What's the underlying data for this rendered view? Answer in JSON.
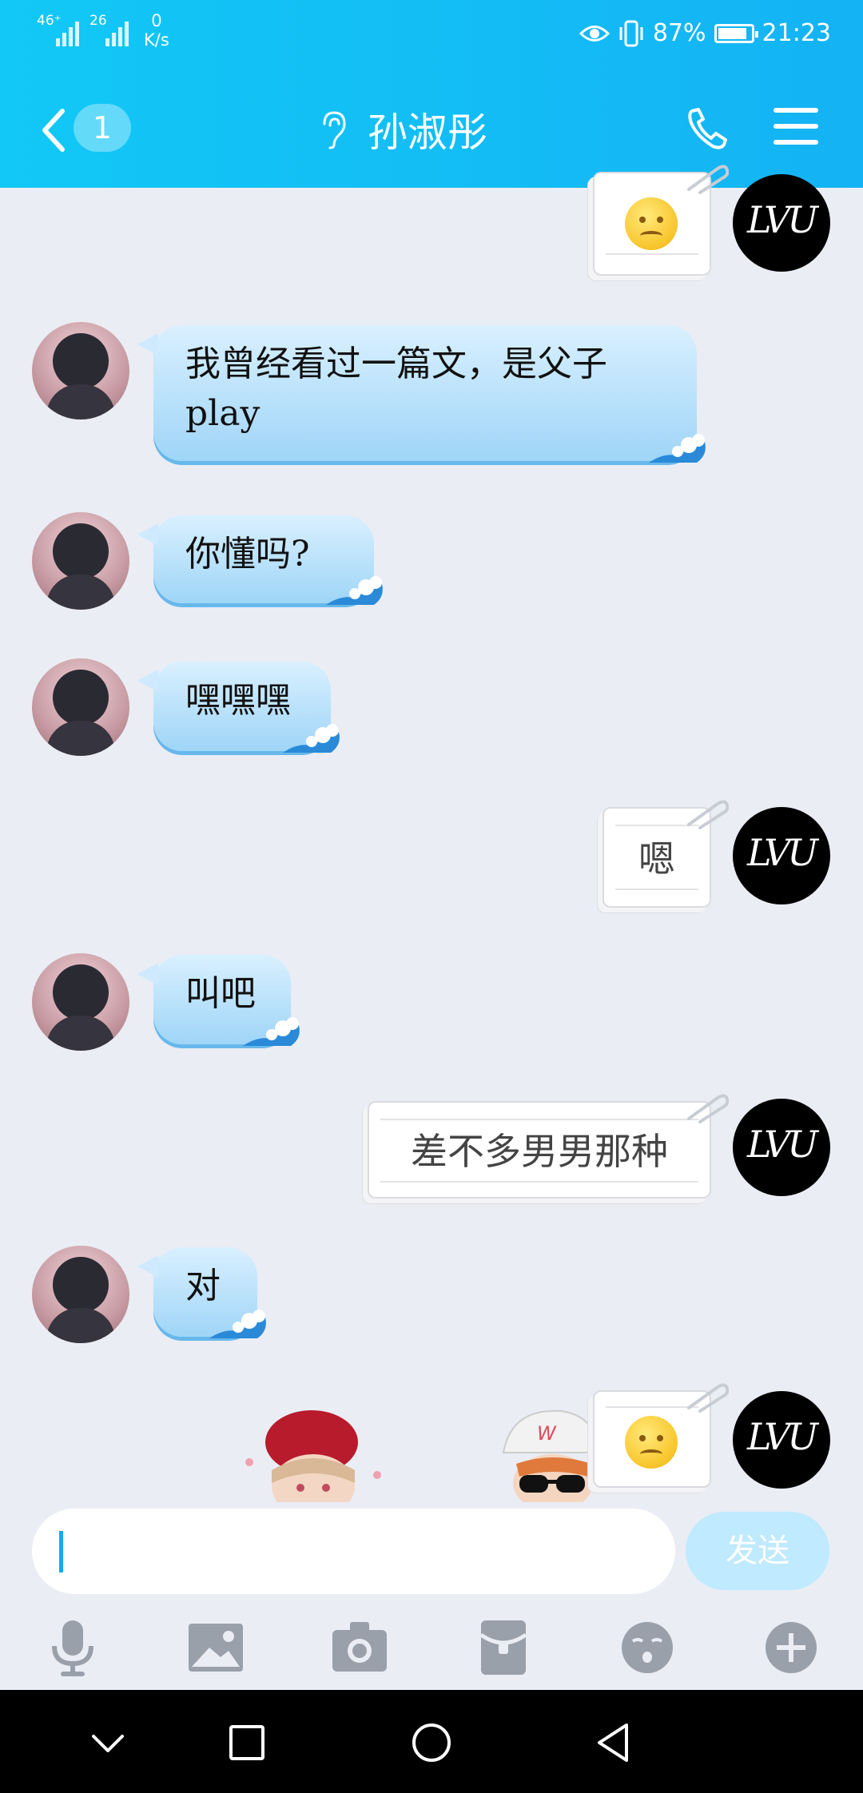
{
  "status_bar": {
    "sim1": "46⁺",
    "sim2": "26",
    "speed_value": "0",
    "speed_unit": "K/s",
    "battery": "87%",
    "time": "21:23",
    "icons": [
      "eye-icon",
      "vibrate-icon",
      "battery-icon"
    ]
  },
  "header": {
    "unread_count": "1",
    "contact_name": "孙淑彤",
    "icons": [
      "back-arrow-icon",
      "earpiece-icon",
      "phone-icon",
      "menu-icon"
    ]
  },
  "messages": [
    {
      "side": "right",
      "type": "emoji",
      "text": ""
    },
    {
      "side": "left",
      "type": "text",
      "text": "我曾经看过一篇文，是父子play"
    },
    {
      "side": "left",
      "type": "text",
      "text": "你懂吗?"
    },
    {
      "side": "left",
      "type": "text",
      "text": "嘿嘿嘿"
    },
    {
      "side": "right",
      "type": "text",
      "text": "嗯"
    },
    {
      "side": "left",
      "type": "text",
      "text": "叫吧"
    },
    {
      "side": "right",
      "type": "text",
      "text": "差不多男男那种"
    },
    {
      "side": "left",
      "type": "text",
      "text": "对"
    },
    {
      "side": "right",
      "type": "emoji",
      "text": ""
    }
  ],
  "input": {
    "value": "",
    "send_label": "发送"
  },
  "toolbar": {
    "icons": [
      "microphone-icon",
      "image-icon",
      "camera-icon",
      "red-packet-icon",
      "emoji-icon",
      "plus-icon"
    ]
  },
  "system_nav": {
    "icons": [
      "collapse-icon",
      "recent-apps-icon",
      "home-icon",
      "back-icon"
    ]
  },
  "colors": {
    "header": "#14b9f5",
    "chat_background": "#eaedf4",
    "bubble_left": "#a9dafa",
    "send_button": "#bfeaff"
  }
}
